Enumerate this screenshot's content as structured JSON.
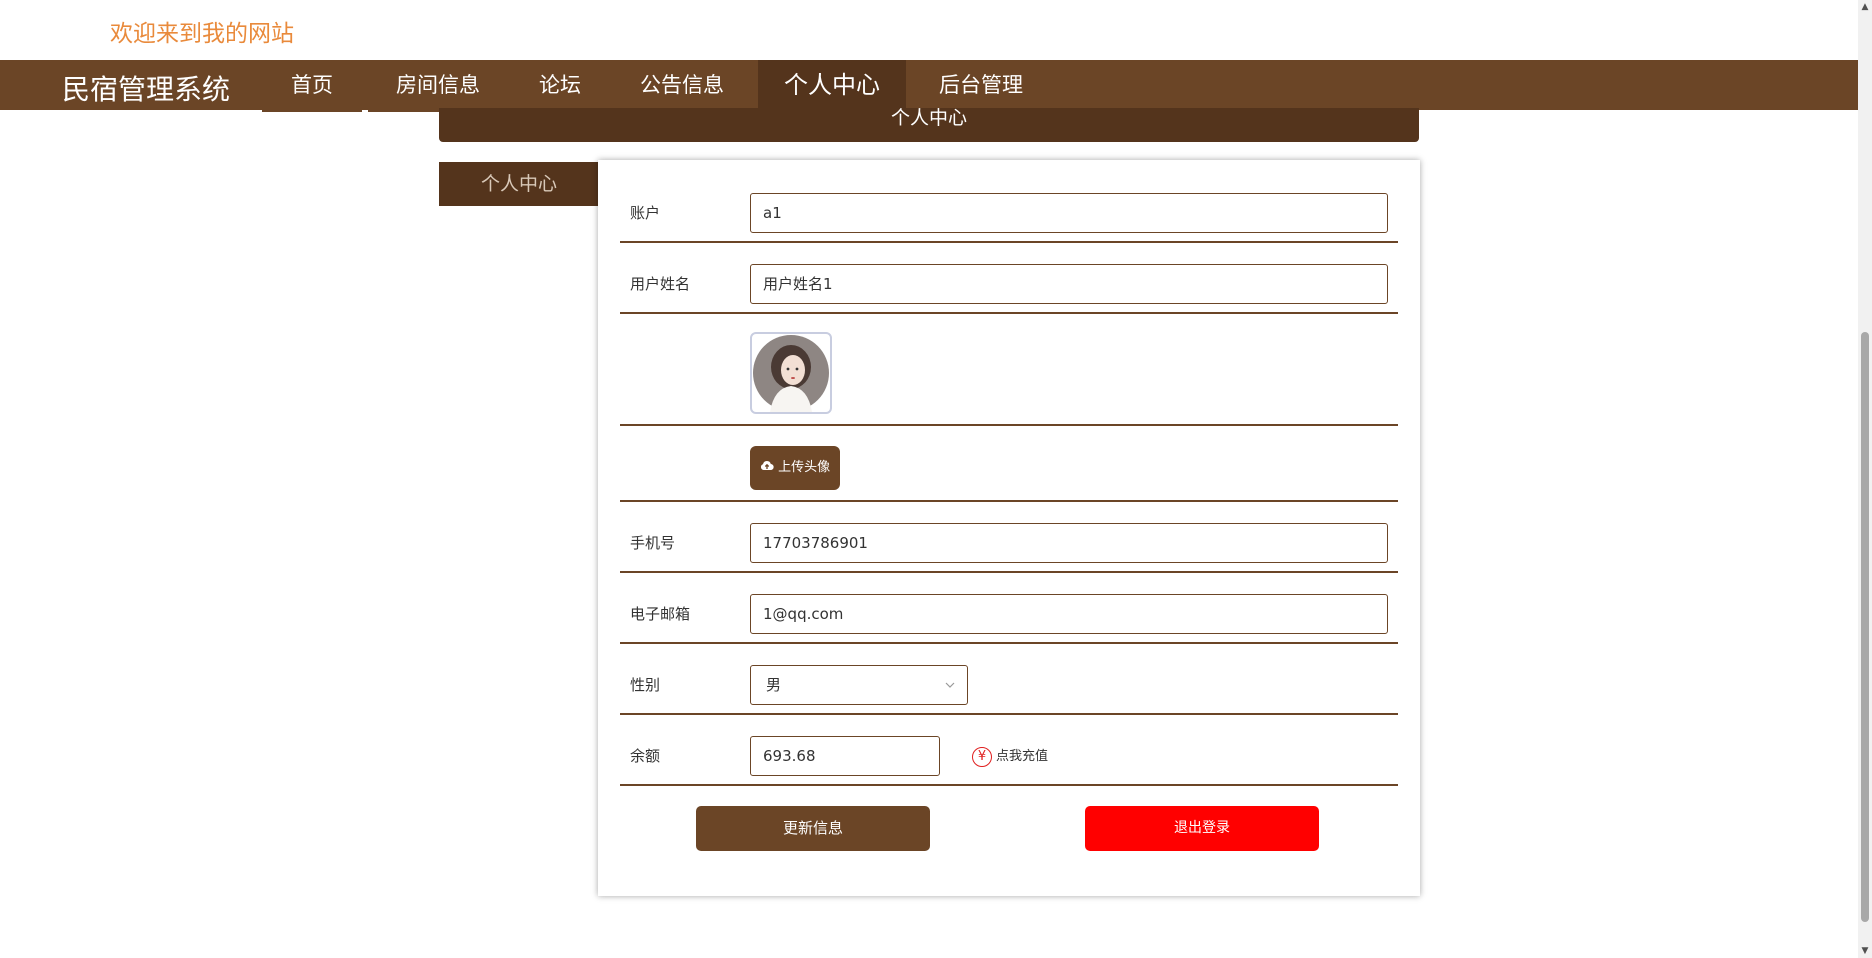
{
  "header": {
    "welcome": "欢迎来到我的网站"
  },
  "nav": {
    "brand": "民宿管理系统",
    "items": [
      {
        "label": "首页"
      },
      {
        "label": "房间信息"
      },
      {
        "label": "论坛"
      },
      {
        "label": "公告信息"
      },
      {
        "label": "个人中心"
      },
      {
        "label": "后台管理"
      }
    ],
    "active": "个人中心"
  },
  "section": {
    "title": "个人中心"
  },
  "sidebar": {
    "tab": "个人中心"
  },
  "form": {
    "account": {
      "label": "账户",
      "value": "a1"
    },
    "username": {
      "label": "用户姓名",
      "value": "用户姓名1"
    },
    "avatar": {
      "alt": "avatar"
    },
    "upload": {
      "label": "上传头像",
      "icon": "cloud-upload-icon"
    },
    "phone": {
      "label": "手机号",
      "value": "17703786901"
    },
    "email": {
      "label": "电子邮箱",
      "value": "1@qq.com"
    },
    "gender": {
      "label": "性别",
      "value": "男"
    },
    "balance": {
      "label": "余额",
      "value": "693.68",
      "recharge": "点我充值",
      "icon": "yen-icon"
    },
    "update_button": "更新信息",
    "logout_button": "退出登录"
  },
  "colors": {
    "primary": "#6b4526",
    "primary_dark": "#54341c",
    "danger": "#ff0000",
    "welcome": "#e98a3b"
  }
}
